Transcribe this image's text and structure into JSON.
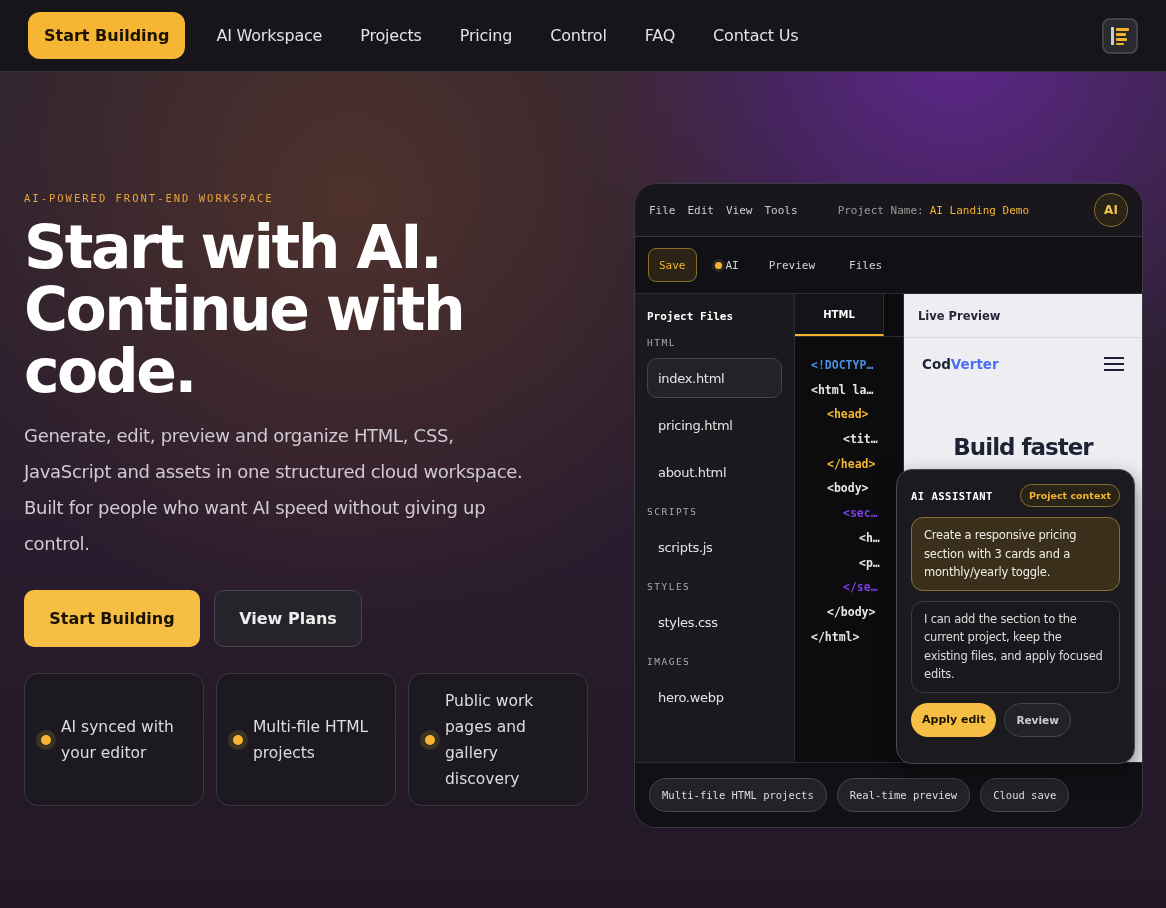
{
  "nav": {
    "cta": "Start Building",
    "links": [
      "AI Workspace",
      "Projects",
      "Pricing",
      "Control",
      "FAQ",
      "Contact Us"
    ]
  },
  "hero": {
    "eyebrow": "AI-POWERED FRONT-END WORKSPACE",
    "title_lines": [
      "Start with AI.",
      "Continue with",
      "code."
    ],
    "description": "Generate, edit, preview and organize HTML, CSS, JavaScript and assets in one structured cloud workspace. Built for people who want AI speed without giving up control.",
    "primary_button": "Start Building",
    "secondary_button": "View Plans",
    "features": [
      "AI synced with your editor",
      "Multi-file HTML projects",
      "Public work pages and gallery discovery"
    ]
  },
  "editor": {
    "menu": [
      "File",
      "Edit",
      "View",
      "Tools"
    ],
    "project_label": "Project Name:",
    "project_name": "AI Landing Demo",
    "avatar": "AI",
    "toolbar": [
      {
        "label": "Save",
        "kind": "button"
      },
      {
        "label": "AI",
        "kind": "dot"
      },
      {
        "label": "Preview",
        "kind": "plain"
      },
      {
        "label": "Files",
        "kind": "plain"
      }
    ],
    "files_title": "Project Files",
    "file_groups": [
      {
        "label": "HTML",
        "files": [
          {
            "name": "index.html",
            "selected": true
          },
          {
            "name": "pricing.html",
            "selected": false
          },
          {
            "name": "about.html",
            "selected": false
          }
        ]
      },
      {
        "label": "SCRIPTS",
        "files": [
          {
            "name": "scripts.js",
            "selected": false
          }
        ]
      },
      {
        "label": "STYLES",
        "files": [
          {
            "name": "styles.css",
            "selected": false
          }
        ]
      },
      {
        "label": "IMAGES",
        "files": [
          {
            "name": "hero.webp",
            "selected": false
          }
        ]
      }
    ],
    "code_tabs": [
      {
        "label": "HTML",
        "selected": true
      }
    ],
    "code": [
      {
        "text": "<!DOCTYP…",
        "color": "#4a90e2"
      },
      {
        "text": "<html la…",
        "color": "#e6e6e6",
        "children": [
          {
            "text": "<head>",
            "color": "#f2b632",
            "children": [
              {
                "text": "<tit…",
                "color": "#e6e6e6"
              }
            ]
          },
          {
            "text": "</head>",
            "color": "#f2b632"
          },
          {
            "text": "<body>",
            "color": "#e6e6e6",
            "children": [
              {
                "text": "<sec…",
                "color": "#7b3fe4",
                "children": [
                  {
                    "text": "<h…",
                    "color": "#e6e6e6"
                  },
                  {
                    "text": "<p…",
                    "color": "#e6e6e6"
                  }
                ]
              },
              {
                "text": "</se…",
                "color": "#7b3fe4"
              }
            ]
          },
          {
            "text": "</body>",
            "color": "#e6e6e6"
          }
        ]
      },
      {
        "text": "</html>",
        "color": "#e6e6e6"
      }
    ],
    "preview": {
      "title": "Live Preview",
      "brand_a": "Cod",
      "brand_b": "Verter",
      "heading": "Build faster"
    },
    "assistant": {
      "title": "AI ASSISTANT",
      "badge": "Project context",
      "messages": [
        {
          "kind": "user",
          "text": "Create a responsive pricing section with 3 cards and a monthly/yearly toggle."
        },
        {
          "kind": "ai",
          "text": "I can add the section to the current project, keep the existing files, and apply focused edits."
        }
      ],
      "apply": "Apply edit",
      "review": "Review"
    },
    "chips": [
      "Multi-file HTML projects",
      "Real-time preview",
      "Cloud save"
    ]
  }
}
